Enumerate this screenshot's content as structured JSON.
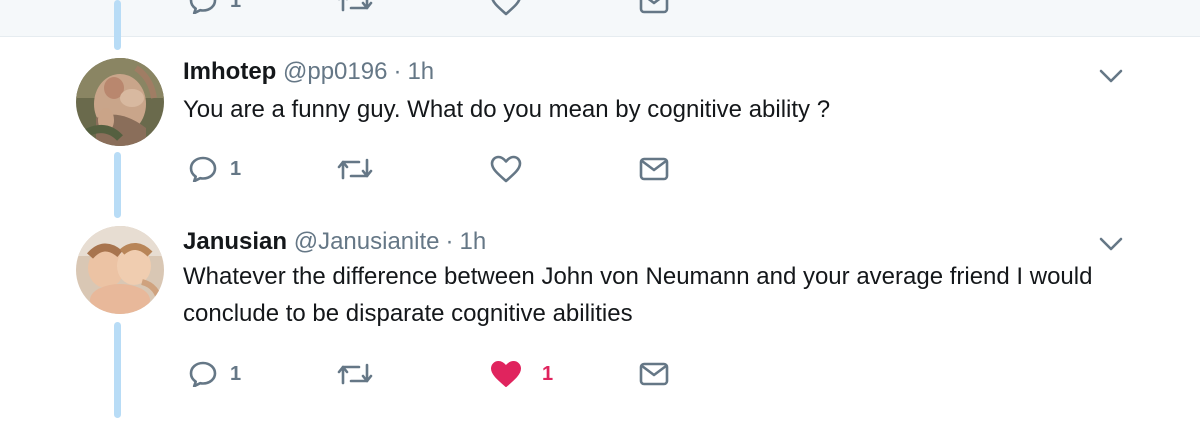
{
  "previous_tweet": {
    "reply_count": "1"
  },
  "tweets": [
    {
      "name": "Imhotep",
      "handle": "@pp0196",
      "separator": "·",
      "time": "1h",
      "text": "You are a funny guy. What do you mean by cognitive ability ?",
      "avatar_icon": "classical-painting-avatar",
      "actions": {
        "reply_count": "1",
        "retweet_count": "",
        "like_count": "",
        "liked": false
      }
    },
    {
      "name": "Janusian",
      "handle": "@Janusianite",
      "separator": "·",
      "time": "1h",
      "text": "Whatever the difference between John von Neumann and your average friend I would conclude to be disparate cognitive abilities",
      "avatar_icon": "cherubs-painting-avatar",
      "actions": {
        "reply_count": "1",
        "retweet_count": "",
        "like_count": "1",
        "liked": true
      }
    }
  ],
  "colors": {
    "thread_line": "#b8dcf6",
    "secondary_text": "#657786",
    "like_active": "#e0245e",
    "previous_tweet_bg": "#f5f8fa"
  }
}
